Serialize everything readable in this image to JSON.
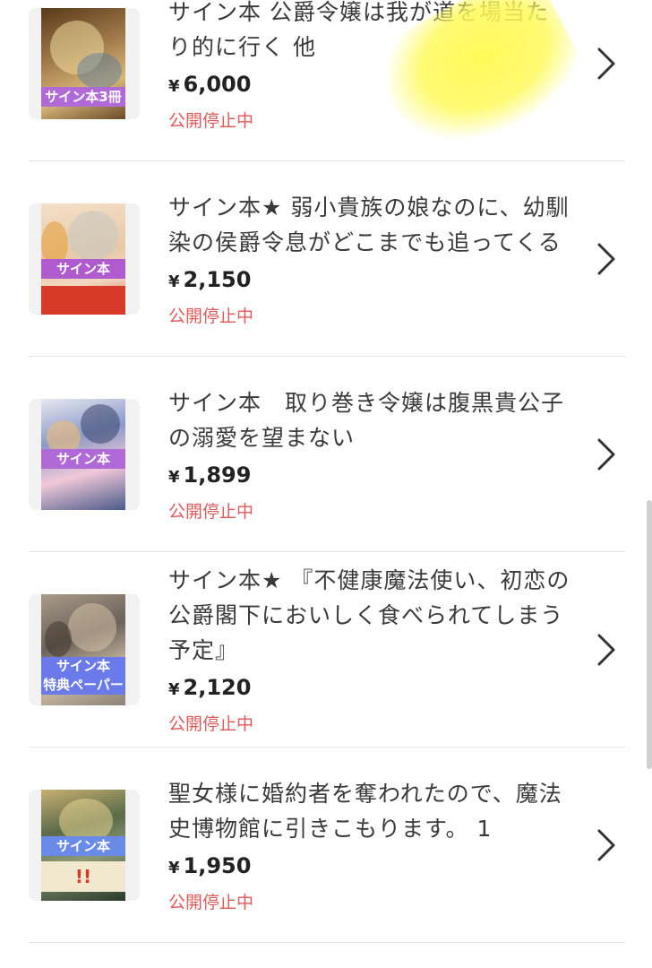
{
  "items": [
    {
      "title": "サイン本 公爵令嬢は我が道を場当たり的に行く 他",
      "price": "6,000",
      "currency": "¥",
      "status": "公開停止中",
      "band_text": "サイン本3冊",
      "colors": {
        "cover": "#8a6a3a",
        "band": "#b06ad8",
        "accent": "#e8d08a"
      }
    },
    {
      "title": "サイン本★ 弱小貴族の娘なのに、幼馴染の侯爵令息がどこまでも追ってくる",
      "price": "2,150",
      "currency": "¥",
      "status": "公開停止中",
      "band_text": "サイン本",
      "colors": {
        "cover": "#f0d9c0",
        "band": "#b05ad0",
        "accent": "#e8402a"
      }
    },
    {
      "title": "サイン本　取り巻き令嬢は腹黒貴公子の溺愛を望まない",
      "price": "1,899",
      "currency": "¥",
      "status": "公開停止中",
      "band_text": "サイン本",
      "colors": {
        "cover": "#6a7aa8",
        "band": "#b06ad8",
        "accent": "#e8a8c8"
      }
    },
    {
      "title": "サイン本★ 『不健康魔法使い、初恋の公爵閣下においしく食べられてしまう予定』",
      "price": "2,120",
      "currency": "¥",
      "status": "公開停止中",
      "band_text": "サイン本\n特典ペーパー",
      "colors": {
        "cover": "#8a8278",
        "band": "#6a7ae8",
        "accent": "#c8b89a"
      }
    },
    {
      "title": "聖女様に婚約者を奪われたので、魔法史博物館に引きこもります。 1",
      "price": "1,950",
      "currency": "¥",
      "status": "公開停止中",
      "band_text": "サイン本",
      "colors": {
        "cover": "#6a7a5a",
        "band": "#6a8ae8",
        "accent": "#e8c84a"
      }
    }
  ]
}
